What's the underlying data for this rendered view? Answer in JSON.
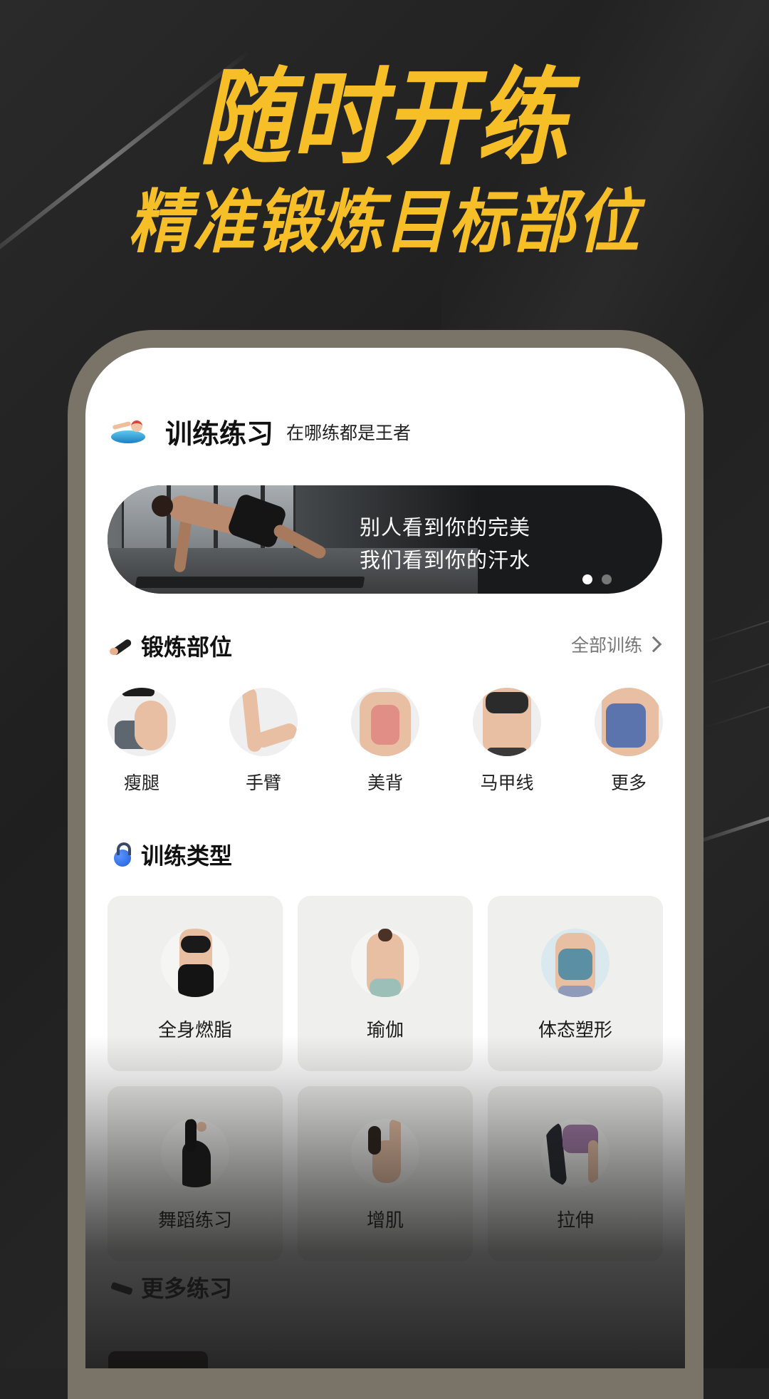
{
  "promo": {
    "headline": "随时开练",
    "subheadline": "精准锻炼目标部位",
    "accent_color": "#f6be27"
  },
  "app": {
    "header": {
      "icon": "swimmer-icon",
      "title": "训练练习",
      "tagline": "在哪练都是王者"
    },
    "banner": {
      "line1": "别人看到你的完美",
      "line2": "我们看到你的汗水",
      "slides_total": 2,
      "active_slide": 1,
      "dot_active_color": "#ffffff",
      "dot_inactive_color": "#777777"
    },
    "body_parts": {
      "icon": "flexed-arm-icon",
      "title": "锻炼部位",
      "see_all": "全部训练",
      "items": [
        {
          "label": "瘦腿"
        },
        {
          "label": "手臂"
        },
        {
          "label": "美背"
        },
        {
          "label": "马甲线"
        },
        {
          "label": "更多"
        }
      ]
    },
    "training_types": {
      "icon": "kettlebell-icon",
      "title": "训练类型",
      "items": [
        {
          "label": "全身燃脂"
        },
        {
          "label": "瑜伽"
        },
        {
          "label": "体态塑形"
        },
        {
          "label": "舞蹈练习"
        },
        {
          "label": "增肌"
        },
        {
          "label": "拉伸"
        }
      ]
    },
    "more_practice": {
      "icon": "exercise-block-icon",
      "title": "更多练习"
    }
  }
}
